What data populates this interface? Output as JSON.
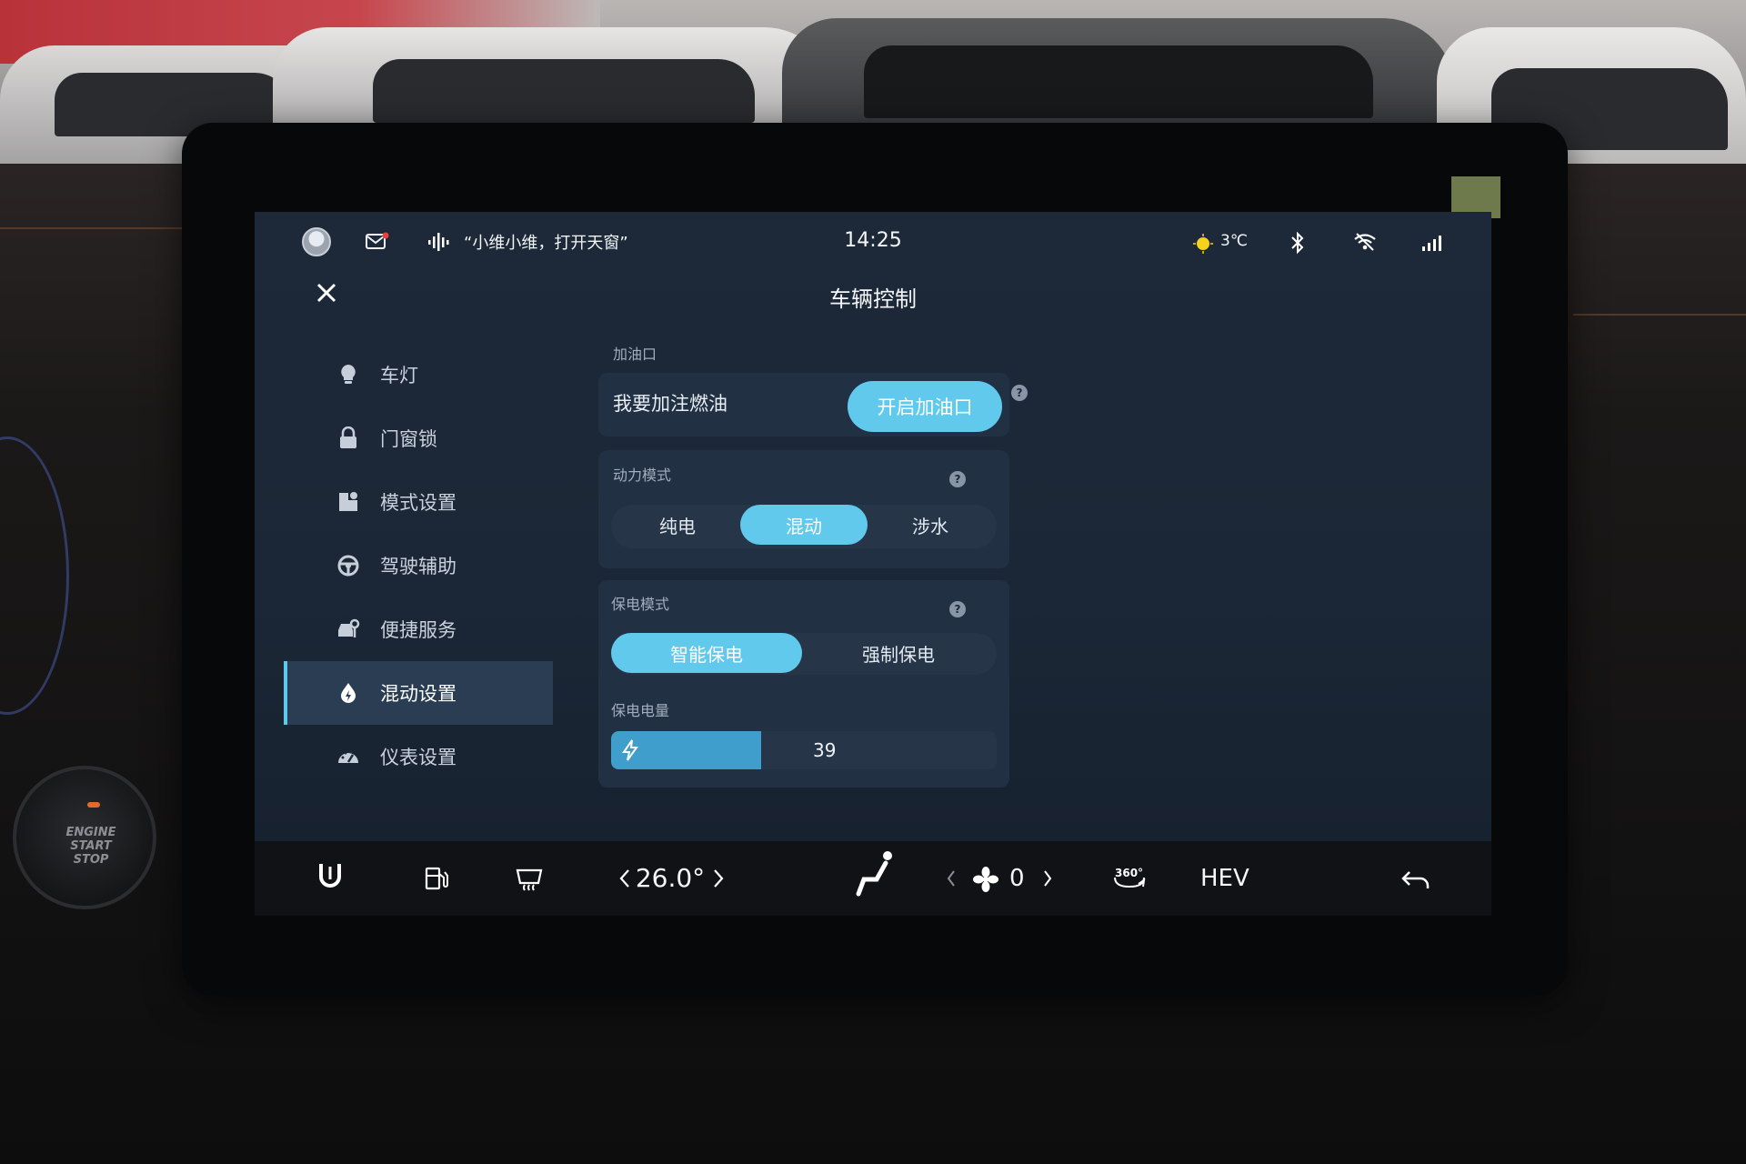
{
  "status_bar": {
    "voice_hint": "“小维小维，打开天窗”",
    "time": "14:25",
    "temperature": "3℃",
    "icons": [
      "avatar-icon",
      "mail-icon",
      "voice-icon",
      "sun-icon",
      "bluetooth-icon",
      "wifi-icon",
      "signal-icon"
    ]
  },
  "header": {
    "title": "车辆控制",
    "close_icon": "close-icon"
  },
  "sidebar": {
    "active_index": 5,
    "items": [
      {
        "label": "车灯",
        "icon": "light-bulb-icon"
      },
      {
        "label": "门窗锁",
        "icon": "lock-icon"
      },
      {
        "label": "模式设置",
        "icon": "mode-icon"
      },
      {
        "label": "驾驶辅助",
        "icon": "steering-wheel-icon"
      },
      {
        "label": "便捷服务",
        "icon": "service-icon"
      },
      {
        "label": "混动设置",
        "icon": "hybrid-drop-icon"
      },
      {
        "label": "仪表设置",
        "icon": "gauge-icon"
      }
    ]
  },
  "fuel_port": {
    "section_label": "加油口",
    "text": "我要加注燃油",
    "button_label": "开启加油口"
  },
  "power_mode": {
    "section_label": "动力模式",
    "options": [
      "纯电",
      "混动",
      "涉水"
    ],
    "selected": "混动"
  },
  "battery_save": {
    "section_label": "保电模式",
    "options": [
      "智能保电",
      "强制保电"
    ],
    "selected": "智能保电",
    "level_label": "保电电量",
    "level_value": "39",
    "level_fraction": 0.39
  },
  "dock": {
    "temperature": "26.0°",
    "fan_level": "0",
    "view_360": "360°",
    "mode_label": "HEV",
    "icons": [
      "shield-u-icon",
      "fuel-pump-icon",
      "rear-defrost-icon",
      "chevron-left-icon",
      "chevron-right-icon",
      "seat-icon",
      "fan-icon",
      "camera-360-icon",
      "back-icon"
    ]
  },
  "colors": {
    "accent": "#61c9ec",
    "screen_bg": "#1d2938",
    "card_bg": "#223044",
    "active_nav": "#2a3d53"
  }
}
